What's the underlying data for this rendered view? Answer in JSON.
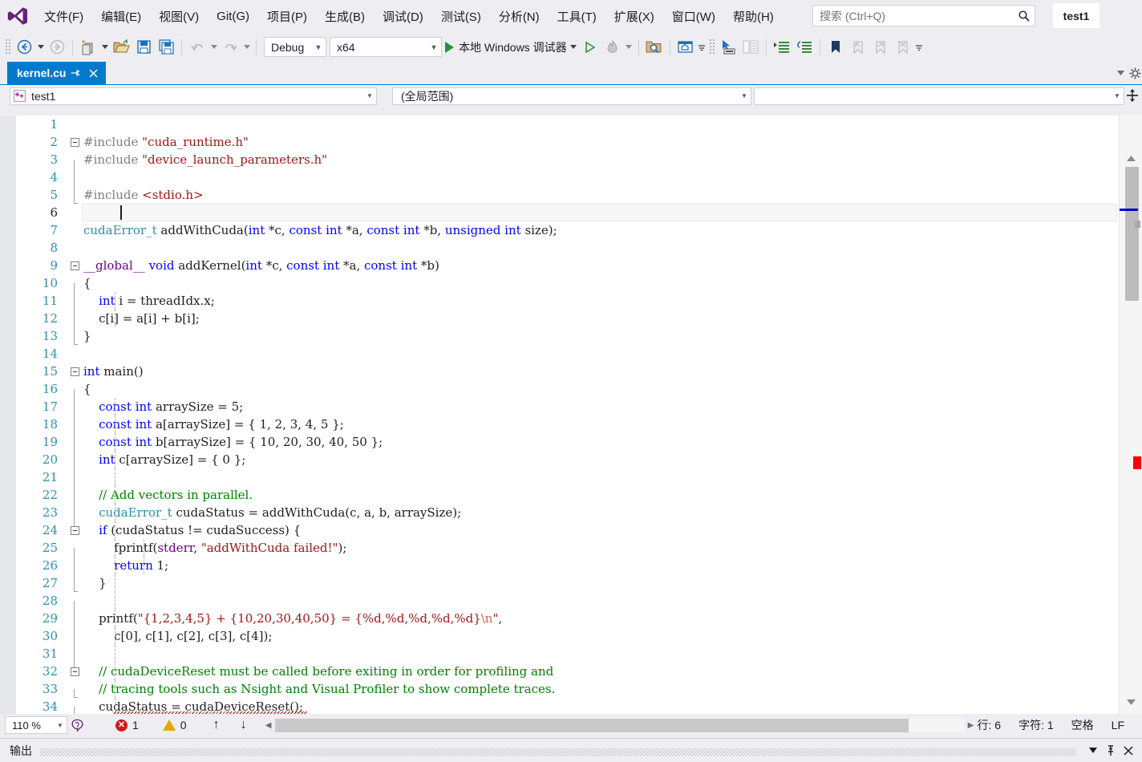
{
  "menubar": {
    "logo": "vs-logo-icon",
    "items": [
      {
        "label": "文件(F)"
      },
      {
        "label": "编辑(E)"
      },
      {
        "label": "视图(V)"
      },
      {
        "label": "Git(G)"
      },
      {
        "label": "项目(P)"
      },
      {
        "label": "生成(B)"
      },
      {
        "label": "调试(D)"
      },
      {
        "label": "测试(S)"
      },
      {
        "label": "分析(N)"
      },
      {
        "label": "工具(T)"
      },
      {
        "label": "扩展(X)"
      },
      {
        "label": "窗口(W)"
      },
      {
        "label": "帮助(H)"
      }
    ],
    "search_placeholder": "搜索 (Ctrl+Q)",
    "project_badge": "test1"
  },
  "toolbar": {
    "back_label": "后退",
    "forward_label": "前进",
    "new_item_label": "新建项",
    "open_label": "打开文件",
    "save_label": "保存",
    "save_all_label": "全部保存",
    "undo_label": "撤消",
    "redo_label": "恢复",
    "config_value": "Debug",
    "platform_value": "x64",
    "run_label": "本地 Windows 调试器",
    "attach_label": "附加",
    "hotreload_label": "热重载",
    "find_label": "在文件中查找",
    "home_label": "起始页",
    "pointer_label": "指针",
    "compare_label": "比较",
    "indent_label": "增加缩进",
    "outdent_label": "减少缩进",
    "bookmark_label": "切换书签",
    "prev_bookmark_label": "上一书签",
    "next_bookmark_label": "下一书签",
    "clear_bookmarks_label": "清除书签",
    "overflow_label": "更多"
  },
  "tabstrip": {
    "active_tab": "kernel.cu",
    "pin_glyph": "⇥",
    "close_glyph": "✕"
  },
  "navbar": {
    "project": "test1",
    "scope": "(全局范围)",
    "member": ""
  },
  "editor": {
    "font_family": "monospace-serif",
    "current_line": 6,
    "lines": [
      {
        "n": 1,
        "fold": "",
        "guides": [],
        "tokens": []
      },
      {
        "n": 2,
        "fold": "minus",
        "guides": [],
        "tokens": [
          {
            "t": "#include ",
            "c": "pp"
          },
          {
            "t": "\"cuda_runtime.h\"",
            "c": "str"
          }
        ]
      },
      {
        "n": 3,
        "fold": "bar",
        "guides": [],
        "tokens": [
          {
            "t": "#include ",
            "c": "pp"
          },
          {
            "t": "\"device_launch_parameters.h\"",
            "c": "str"
          }
        ]
      },
      {
        "n": 4,
        "fold": "bar",
        "guides": [],
        "tokens": []
      },
      {
        "n": 5,
        "fold": "barend",
        "guides": [],
        "tokens": [
          {
            "t": "#include ",
            "c": "pp"
          },
          {
            "t": "<stdio.h>",
            "c": "str"
          }
        ]
      },
      {
        "n": 6,
        "fold": "",
        "guides": [],
        "tokens": []
      },
      {
        "n": 7,
        "fold": "",
        "guides": [],
        "tokens": [
          {
            "t": "cudaError_t",
            "c": "type"
          },
          {
            "t": " addWithCuda(",
            "c": "plain"
          },
          {
            "t": "int",
            "c": "kw"
          },
          {
            "t": " *c, ",
            "c": "plain"
          },
          {
            "t": "const",
            "c": "kw"
          },
          {
            "t": " ",
            "c": "plain"
          },
          {
            "t": "int",
            "c": "kw"
          },
          {
            "t": " *a, ",
            "c": "plain"
          },
          {
            "t": "const",
            "c": "kw"
          },
          {
            "t": " ",
            "c": "plain"
          },
          {
            "t": "int",
            "c": "kw"
          },
          {
            "t": " *b, ",
            "c": "plain"
          },
          {
            "t": "unsigned",
            "c": "kw"
          },
          {
            "t": " ",
            "c": "plain"
          },
          {
            "t": "int",
            "c": "kw"
          },
          {
            "t": " size);",
            "c": "plain"
          }
        ]
      },
      {
        "n": 8,
        "fold": "",
        "guides": [],
        "tokens": []
      },
      {
        "n": 9,
        "fold": "minus",
        "guides": [],
        "tokens": [
          {
            "t": "__global__",
            "c": "mac"
          },
          {
            "t": " ",
            "c": "plain"
          },
          {
            "t": "void",
            "c": "kw"
          },
          {
            "t": " addKernel(",
            "c": "plain"
          },
          {
            "t": "int",
            "c": "kw"
          },
          {
            "t": " *c, ",
            "c": "plain"
          },
          {
            "t": "const",
            "c": "kw"
          },
          {
            "t": " ",
            "c": "plain"
          },
          {
            "t": "int",
            "c": "kw"
          },
          {
            "t": " *a, ",
            "c": "plain"
          },
          {
            "t": "const",
            "c": "kw"
          },
          {
            "t": " ",
            "c": "plain"
          },
          {
            "t": "int",
            "c": "kw"
          },
          {
            "t": " *b)",
            "c": "plain"
          }
        ]
      },
      {
        "n": 10,
        "fold": "bar",
        "guides": [],
        "tokens": [
          {
            "t": "{",
            "c": "plain"
          }
        ]
      },
      {
        "n": 11,
        "fold": "bar",
        "guides": [
          1
        ],
        "tokens": [
          {
            "t": "    ",
            "c": "plain"
          },
          {
            "t": "int",
            "c": "kw"
          },
          {
            "t": " i = threadIdx.x;",
            "c": "plain"
          }
        ]
      },
      {
        "n": 12,
        "fold": "bar",
        "guides": [
          1
        ],
        "tokens": [
          {
            "t": "    c[i] = a[i] + b[i];",
            "c": "plain"
          }
        ]
      },
      {
        "n": 13,
        "fold": "barend",
        "guides": [],
        "tokens": [
          {
            "t": "}",
            "c": "plain"
          }
        ]
      },
      {
        "n": 14,
        "fold": "",
        "guides": [],
        "tokens": []
      },
      {
        "n": 15,
        "fold": "minus",
        "guides": [],
        "tokens": [
          {
            "t": "int",
            "c": "kw"
          },
          {
            "t": " main()",
            "c": "plain"
          }
        ]
      },
      {
        "n": 16,
        "fold": "bar",
        "guides": [],
        "tokens": [
          {
            "t": "{",
            "c": "plain"
          }
        ]
      },
      {
        "n": 17,
        "fold": "bar",
        "guides": [
          1
        ],
        "tokens": [
          {
            "t": "    ",
            "c": "plain"
          },
          {
            "t": "const",
            "c": "kw"
          },
          {
            "t": " ",
            "c": "plain"
          },
          {
            "t": "int",
            "c": "kw"
          },
          {
            "t": " arraySize = 5;",
            "c": "plain"
          }
        ]
      },
      {
        "n": 18,
        "fold": "bar",
        "guides": [
          1
        ],
        "tokens": [
          {
            "t": "    ",
            "c": "plain"
          },
          {
            "t": "const",
            "c": "kw"
          },
          {
            "t": " ",
            "c": "plain"
          },
          {
            "t": "int",
            "c": "kw"
          },
          {
            "t": " a[arraySize] = { 1, 2, 3, 4, 5 };",
            "c": "plain"
          }
        ]
      },
      {
        "n": 19,
        "fold": "bar",
        "guides": [
          1
        ],
        "tokens": [
          {
            "t": "    ",
            "c": "plain"
          },
          {
            "t": "const",
            "c": "kw"
          },
          {
            "t": " ",
            "c": "plain"
          },
          {
            "t": "int",
            "c": "kw"
          },
          {
            "t": " b[arraySize] = { 10, 20, 30, 40, 50 };",
            "c": "plain"
          }
        ]
      },
      {
        "n": 20,
        "fold": "bar",
        "guides": [
          1
        ],
        "tokens": [
          {
            "t": "    ",
            "c": "plain"
          },
          {
            "t": "int",
            "c": "kw"
          },
          {
            "t": " c[arraySize] = { 0 };",
            "c": "plain"
          }
        ]
      },
      {
        "n": 21,
        "fold": "bar",
        "guides": [
          1
        ],
        "tokens": []
      },
      {
        "n": 22,
        "fold": "bar",
        "guides": [
          1
        ],
        "tokens": [
          {
            "t": "    // Add vectors in parallel.",
            "c": "com"
          }
        ]
      },
      {
        "n": 23,
        "fold": "bar",
        "guides": [
          1
        ],
        "tokens": [
          {
            "t": "    ",
            "c": "plain"
          },
          {
            "t": "cudaError_t",
            "c": "type"
          },
          {
            "t": " cudaStatus = addWithCuda(c, a, b, arraySize);",
            "c": "plain"
          }
        ]
      },
      {
        "n": 24,
        "fold": "minus",
        "guides": [
          1
        ],
        "tokens": [
          {
            "t": "    ",
            "c": "plain"
          },
          {
            "t": "if",
            "c": "kw"
          },
          {
            "t": " (cudaStatus != cudaSuccess) {",
            "c": "plain"
          }
        ]
      },
      {
        "n": 25,
        "fold": "bar",
        "guides": [
          1,
          2
        ],
        "tokens": [
          {
            "t": "        fprintf(",
            "c": "plain"
          },
          {
            "t": "stderr",
            "c": "mac"
          },
          {
            "t": ", ",
            "c": "plain"
          },
          {
            "t": "\"addWithCuda failed!\"",
            "c": "str"
          },
          {
            "t": ");",
            "c": "plain"
          }
        ]
      },
      {
        "n": 26,
        "fold": "bar",
        "guides": [
          1,
          2
        ],
        "tokens": [
          {
            "t": "        ",
            "c": "plain"
          },
          {
            "t": "return",
            "c": "kw"
          },
          {
            "t": " 1;",
            "c": "plain"
          }
        ]
      },
      {
        "n": 27,
        "fold": "barend",
        "guides": [
          1
        ],
        "tokens": [
          {
            "t": "    }",
            "c": "plain"
          }
        ]
      },
      {
        "n": 28,
        "fold": "bar",
        "guides": [
          1
        ],
        "tokens": []
      },
      {
        "n": 29,
        "fold": "bar",
        "guides": [
          1
        ],
        "tokens": [
          {
            "t": "    printf(",
            "c": "plain"
          },
          {
            "t": "\"{1,2,3,4,5} + {10,20,30,40,50} = {%d,%d,%d,%d,%d}",
            "c": "str"
          },
          {
            "t": "\\n",
            "c": "esc"
          },
          {
            "t": "\"",
            "c": "str"
          },
          {
            "t": ",",
            "c": "plain"
          }
        ]
      },
      {
        "n": 30,
        "fold": "bar",
        "guides": [
          1
        ],
        "tokens": [
          {
            "t": "        c[0], c[1], c[2], c[3], c[4]);",
            "c": "plain"
          }
        ]
      },
      {
        "n": 31,
        "fold": "bar",
        "guides": [
          1
        ],
        "tokens": []
      },
      {
        "n": 32,
        "fold": "minus",
        "guides": [
          1
        ],
        "tokens": [
          {
            "t": "    // cudaDeviceReset must be called before exiting in order for profiling and",
            "c": "com"
          }
        ]
      },
      {
        "n": 33,
        "fold": "barend",
        "guides": [
          1
        ],
        "tokens": [
          {
            "t": "    // tracing tools such as Nsight and Visual Profiler to show complete traces.",
            "c": "com"
          }
        ]
      },
      {
        "n": 34,
        "fold": "bar",
        "guides": [
          1
        ],
        "tokens": [
          {
            "t": "    cudaStatus = cudaDeviceReset();",
            "c": "plain"
          }
        ]
      }
    ]
  },
  "edstatus": {
    "zoom": "110 %",
    "intellisense_icon": "intellisense-icon",
    "error_count": "1",
    "warning_count": "0",
    "nav_up": "↑",
    "nav_down": "↓",
    "line_label": "行: 6",
    "char_label": "字符: 1",
    "spaces_label": "空格",
    "eol_label": "LF"
  },
  "outputpanel": {
    "title": "输出",
    "dropdown_glyph": "▼",
    "pin_glyph": "⇱",
    "close_glyph": "✕"
  }
}
